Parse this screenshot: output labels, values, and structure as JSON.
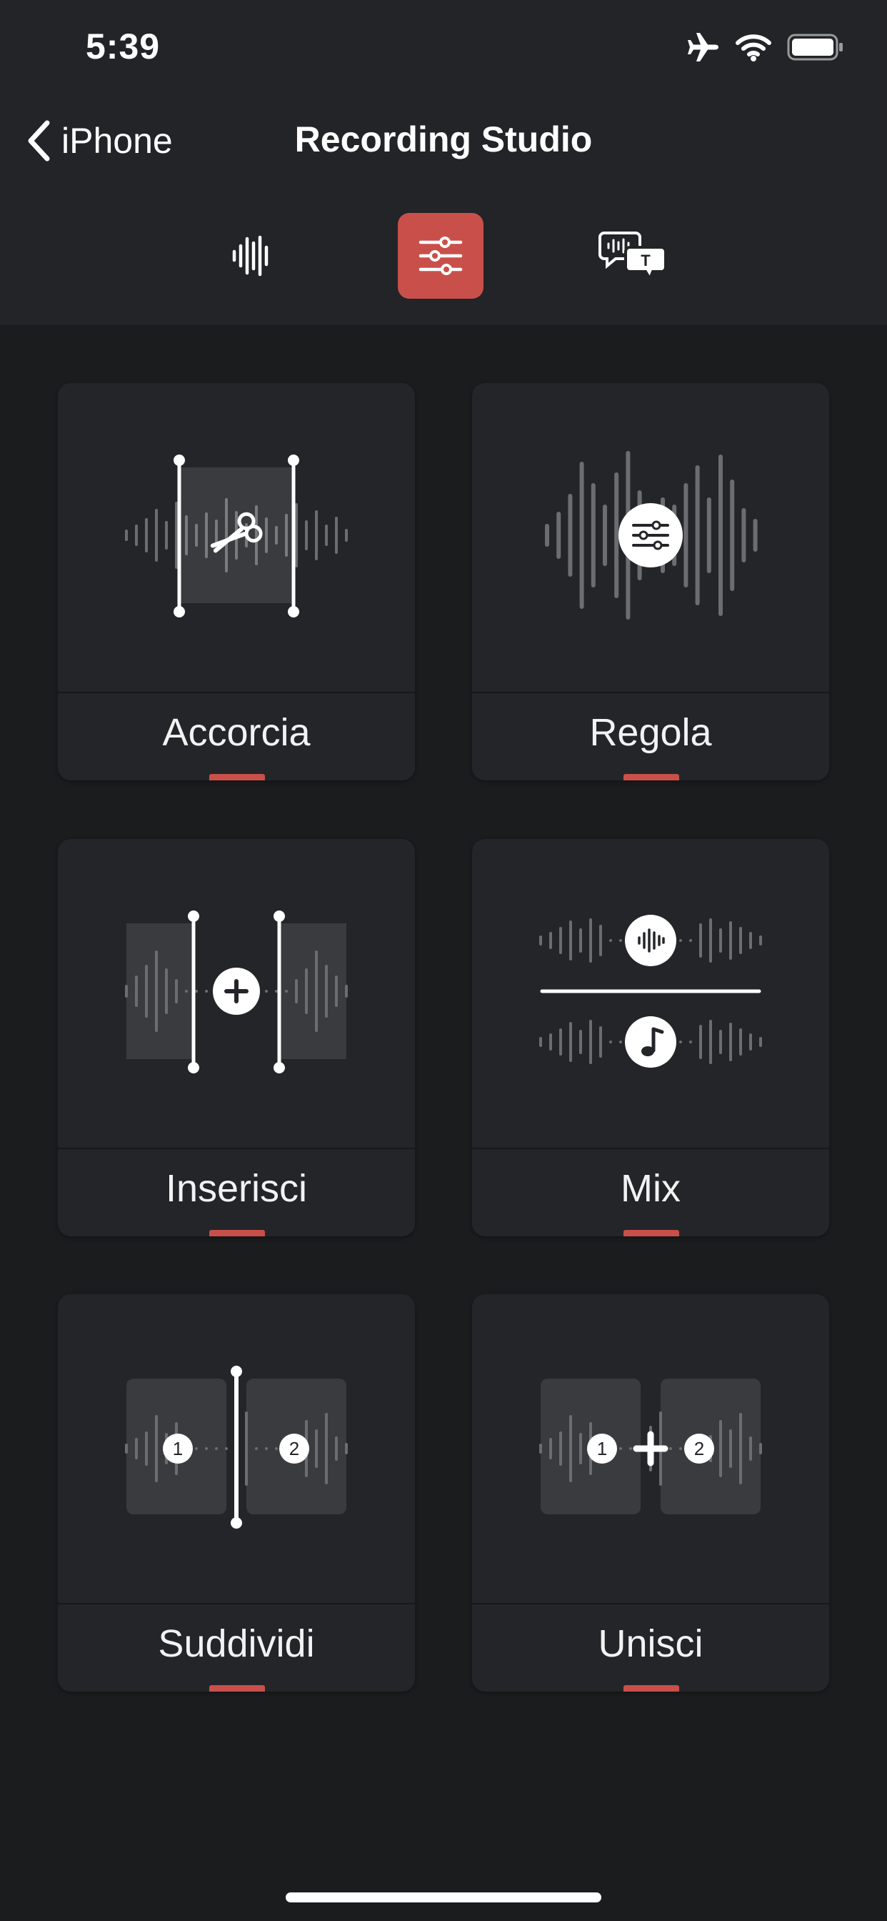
{
  "status_bar": {
    "time": "5:39",
    "icons": [
      "airplane-icon",
      "wifi-icon",
      "battery-icon"
    ]
  },
  "nav": {
    "back_label": "iPhone",
    "back_icon": "chevron-left-icon",
    "title": "Recording Studio"
  },
  "mode_tabs": [
    {
      "icon": "waveform-icon",
      "active": false
    },
    {
      "icon": "sliders-icon",
      "active": true
    },
    {
      "icon": "transcript-bubble-icon",
      "active": false,
      "badge_text": "T"
    }
  ],
  "tools": [
    {
      "label": "Accorcia",
      "icon": "trim-icon"
    },
    {
      "label": "Regola",
      "icon": "adjust-icon"
    },
    {
      "label": "Inserisci",
      "icon": "insert-icon"
    },
    {
      "label": "Mix",
      "icon": "mix-icon"
    },
    {
      "label": "Suddividi",
      "icon": "split-icon",
      "markers": [
        "1",
        "2"
      ]
    },
    {
      "label": "Unisci",
      "icon": "join-icon",
      "markers": [
        "1",
        "2"
      ]
    }
  ],
  "colors": {
    "accent": "#c9504a",
    "background": "#1b1c1e",
    "header": "#232427",
    "card": "#242529"
  }
}
